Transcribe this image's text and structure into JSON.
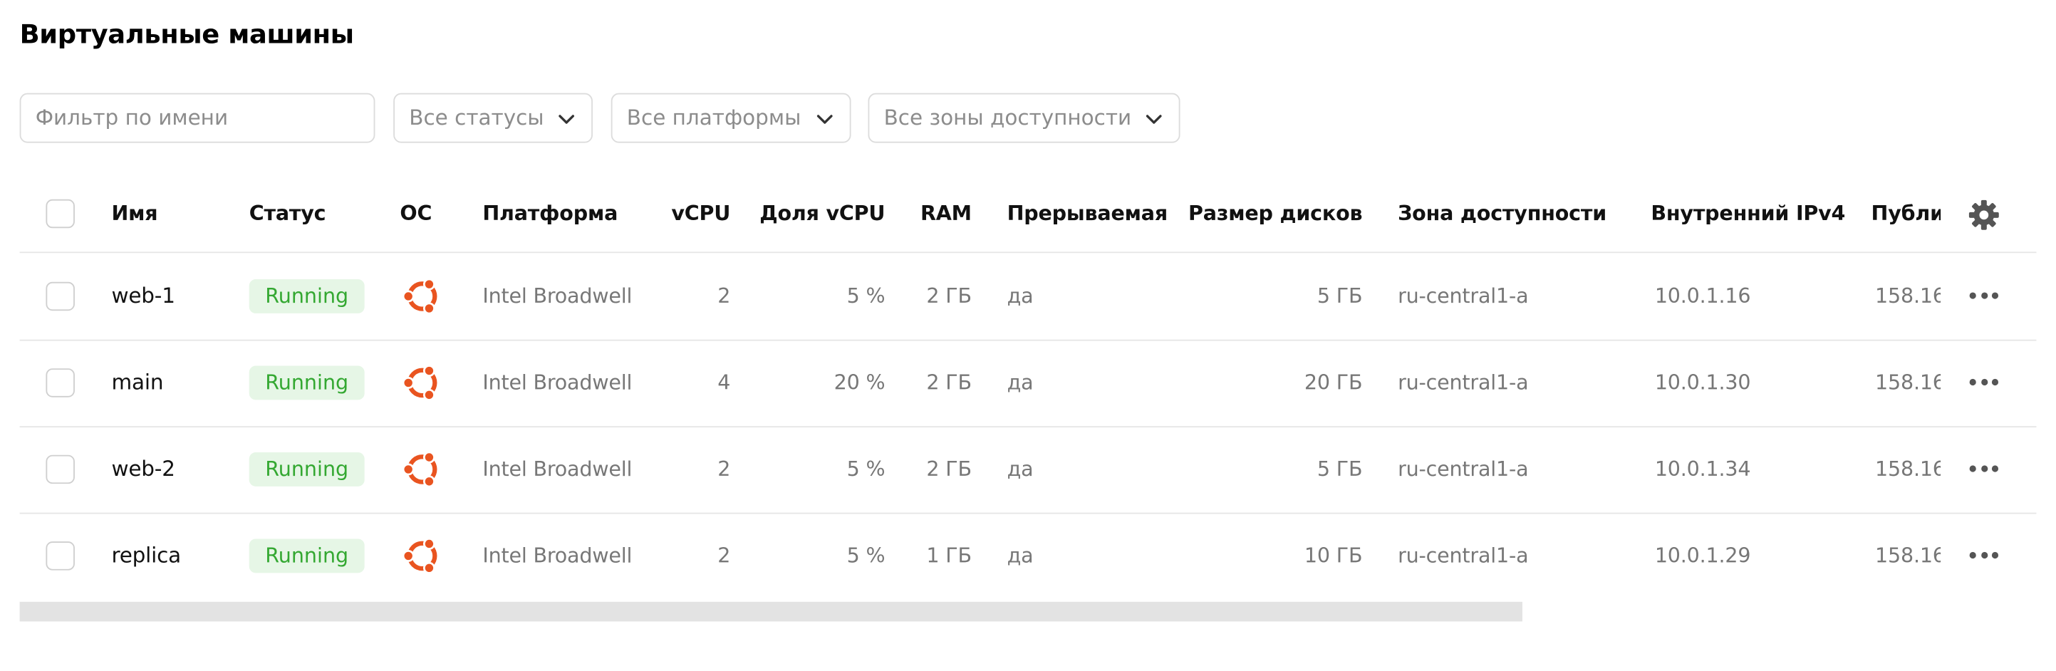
{
  "page": {
    "title": "Виртуальные машины"
  },
  "filters": {
    "name_placeholder": "Фильтр по имени",
    "status": "Все статусы",
    "platform": "Все платформы",
    "zone": "Все зоны доступности"
  },
  "table": {
    "columns": {
      "name": "Имя",
      "status": "Статус",
      "os": "ОС",
      "platform": "Платформа",
      "vcpu": "vCPU",
      "vcpu_share": "Доля vCPU",
      "ram": "RAM",
      "preemptible": "Прерываемая",
      "disk_size": "Размер дисков",
      "zone": "Зона доступности",
      "internal_ipv4": "Внутренний IPv4",
      "public_ipv4": "Публи"
    },
    "rows": [
      {
        "name": "web-1",
        "status": "Running",
        "os": "ubuntu-icon",
        "platform": "Intel Broadwell",
        "vcpu": "2",
        "vcpu_share": "5 %",
        "ram": "2 ГБ",
        "preemptible": "да",
        "disk_size": "5 ГБ",
        "zone": "ru-central1-a",
        "internal_ipv4": "10.0.1.16",
        "public_ipv4": "158.16"
      },
      {
        "name": "main",
        "status": "Running",
        "os": "ubuntu-icon",
        "platform": "Intel Broadwell",
        "vcpu": "4",
        "vcpu_share": "20 %",
        "ram": "2 ГБ",
        "preemptible": "да",
        "disk_size": "20 ГБ",
        "zone": "ru-central1-a",
        "internal_ipv4": "10.0.1.30",
        "public_ipv4": "158.16"
      },
      {
        "name": "web-2",
        "status": "Running",
        "os": "ubuntu-icon",
        "platform": "Intel Broadwell",
        "vcpu": "2",
        "vcpu_share": "5 %",
        "ram": "2 ГБ",
        "preemptible": "да",
        "disk_size": "5 ГБ",
        "zone": "ru-central1-a",
        "internal_ipv4": "10.0.1.34",
        "public_ipv4": "158.16"
      },
      {
        "name": "replica",
        "status": "Running",
        "os": "ubuntu-icon",
        "platform": "Intel Broadwell",
        "vcpu": "2",
        "vcpu_share": "5 %",
        "ram": "1 ГБ",
        "preemptible": "да",
        "disk_size": "10 ГБ",
        "zone": "ru-central1-a",
        "internal_ipv4": "10.0.1.29",
        "public_ipv4": "158.16"
      }
    ]
  },
  "icons": {
    "settings": "gear-icon",
    "row_actions": "more-horizontal-icon",
    "dropdown": "chevron-down-icon"
  },
  "colors": {
    "status_running_bg": "#e6f6e6",
    "status_running_text": "#34a832",
    "ubuntu_orange": "#e95420"
  }
}
